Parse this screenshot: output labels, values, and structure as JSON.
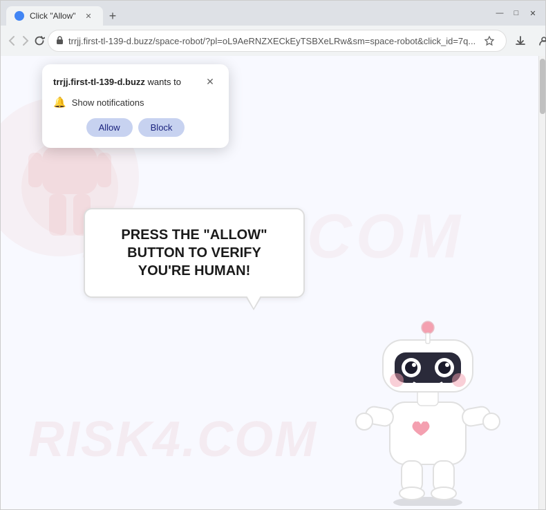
{
  "browser": {
    "tab": {
      "title": "Click \"Allow\"",
      "favicon_color": "#4285f4"
    },
    "address": {
      "url": "trrjj.first-tl-139-d.buzz/space-robot/?pl=oL9AeRNZXECkEyTSBXeLRw&sm=space-robot&click_id=7q...",
      "lock_icon": "🔒"
    },
    "controls": {
      "minimize": "—",
      "maximize": "□",
      "close": "✕",
      "back": "←",
      "forward": "→",
      "refresh": "↻",
      "new_tab": "+"
    }
  },
  "notification_popup": {
    "site_name": "trrjj.first-tl-139-d.buzz",
    "wants_to": " wants to",
    "notification_label": "Show notifications",
    "allow_label": "Allow",
    "block_label": "Block",
    "close_icon": "✕"
  },
  "page": {
    "bubble_text": "PRESS THE \"ALLOW\" BUTTON TO VERIFY YOU'RE HUMAN!",
    "watermark": "RISK4.COM"
  }
}
